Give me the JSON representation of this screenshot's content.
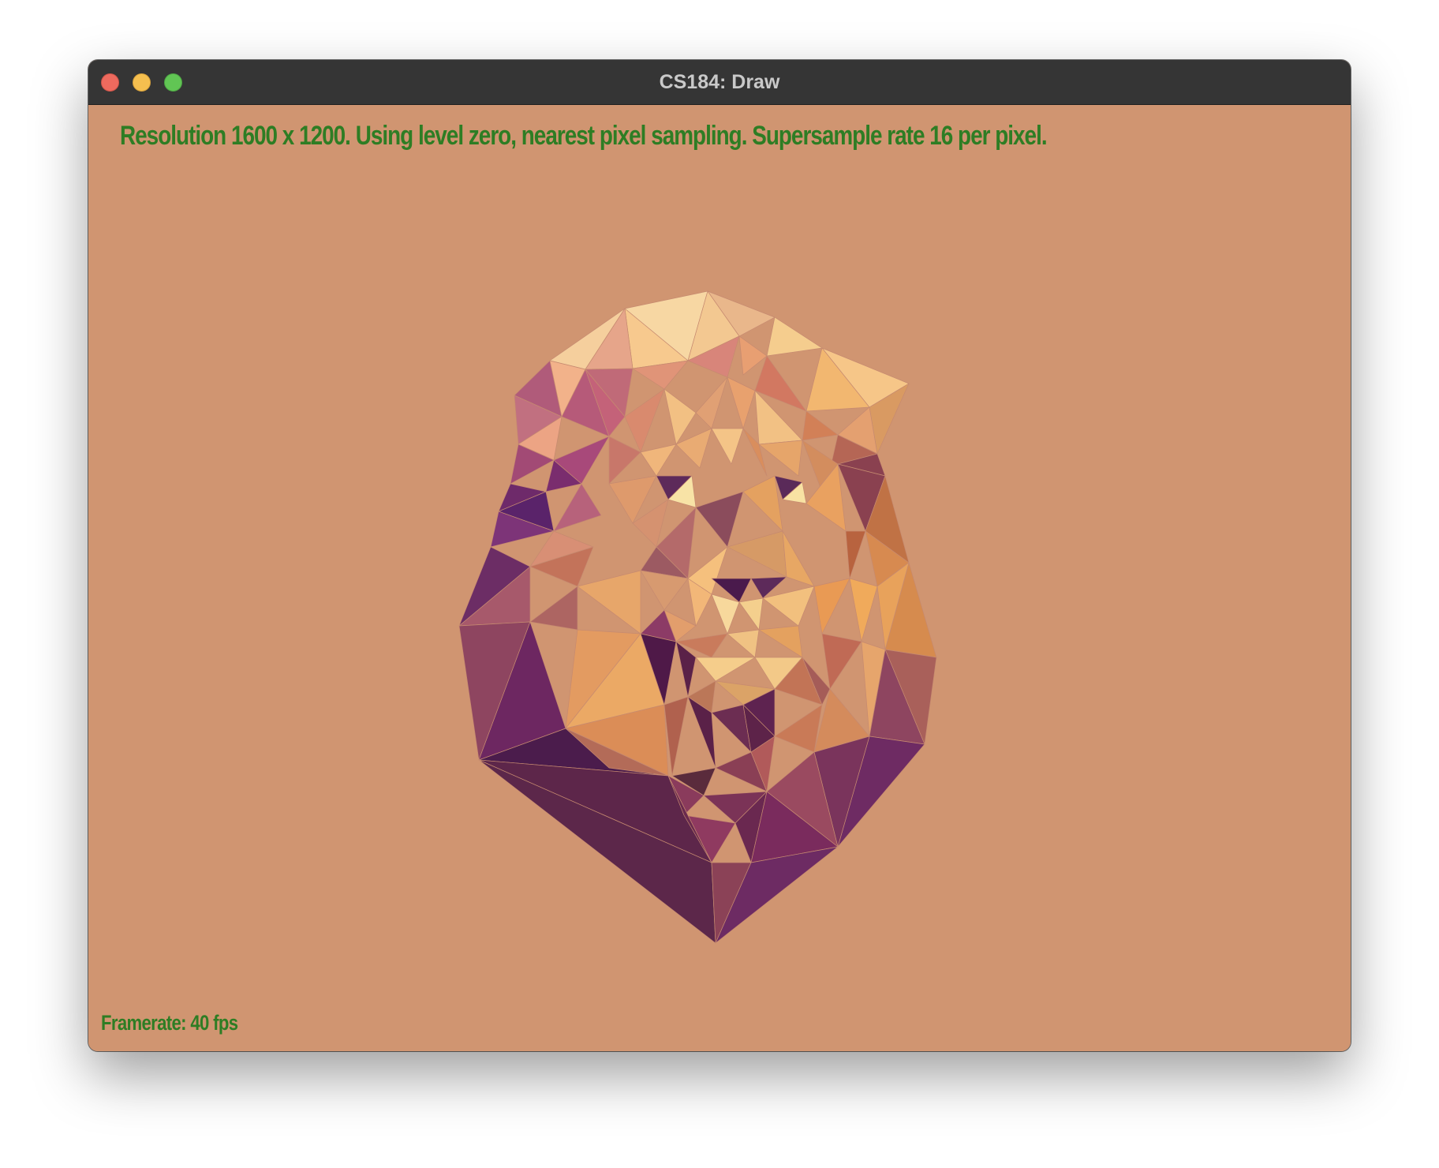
{
  "window": {
    "title": "CS184: Draw"
  },
  "canvas": {
    "background_color": "#d09571",
    "status_text": "Resolution 1600 x 1200. Using level zero, nearest pixel sampling. Supersample rate 16 per pixel.",
    "framerate_text": "Framerate: 40 fps",
    "text_color": "#2e7d24"
  },
  "artwork": {
    "subject": "low-poly-lion-head",
    "palette": [
      "#f7d7a3",
      "#f4c58a",
      "#e8a661",
      "#d98a5d",
      "#b86a69",
      "#8e4a6a",
      "#6e2b61",
      "#4f1f4c",
      "#5d2649"
    ]
  }
}
